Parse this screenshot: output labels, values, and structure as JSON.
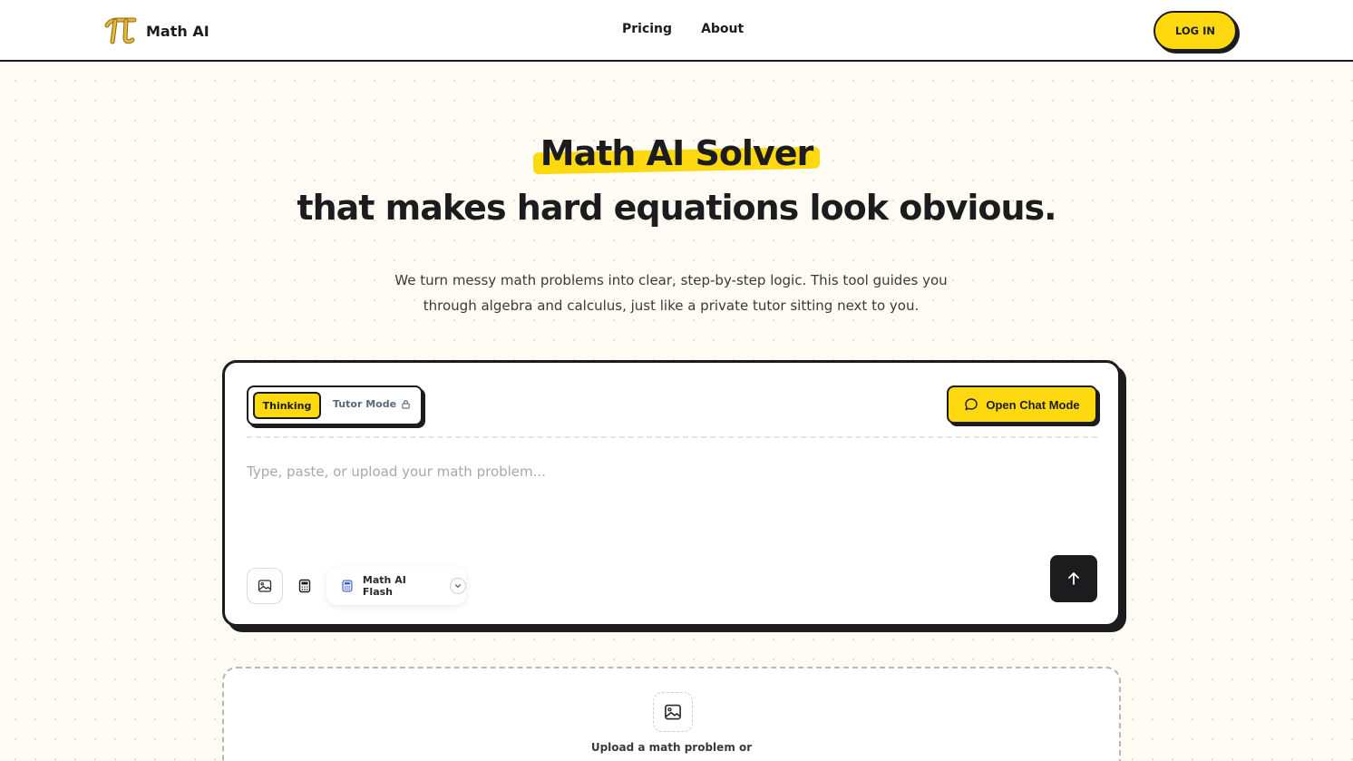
{
  "header": {
    "brand": "Math AI",
    "nav": [
      {
        "label": "Pricing"
      },
      {
        "label": "About"
      }
    ],
    "login_label": "LOG IN"
  },
  "hero": {
    "title_highlight": "Math AI Solver",
    "title_rest": "that makes hard equations look obvious.",
    "description_line1": "We turn messy math problems into clear, step-by-step logic. This tool guides you",
    "description_line2": "through algebra and calculus, just like a private tutor sitting next to you."
  },
  "solver": {
    "mode_thinking": "Thinking",
    "mode_tutor": "Tutor Mode",
    "chat_button": "Open Chat Mode",
    "input_placeholder": "Type, paste, or upload your math problem...",
    "model_label": "Math AI Flash"
  },
  "upload": {
    "text": "Upload a math problem or"
  },
  "colors": {
    "accent": "#ffd90f",
    "ink": "#1c1c1e",
    "background": "#fdfbf4",
    "logo_gold": "#c79a27"
  },
  "icons": {
    "logo": "pi-logo-icon",
    "lock": "lock-icon",
    "chat": "chat-bubble-icon",
    "image": "image-icon",
    "calculator": "calculator-icon",
    "model": "calculator-icon",
    "chevron": "chevron-down-icon",
    "send": "arrow-up-icon"
  }
}
